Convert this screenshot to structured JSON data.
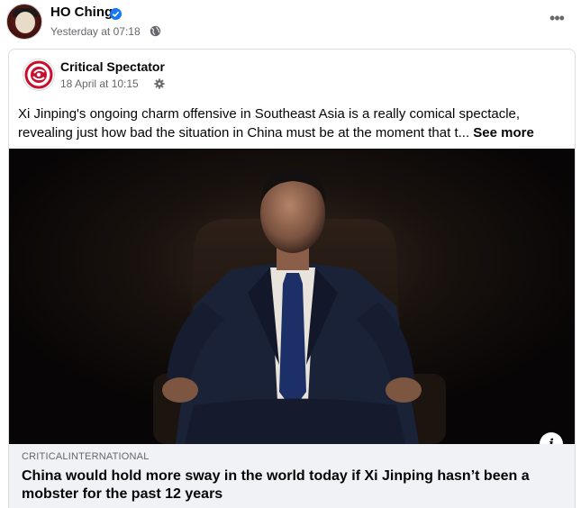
{
  "post": {
    "author_name": "HO Ching",
    "timestamp": "Yesterday at 07:18",
    "verified": true,
    "audience_icon": "globe-icon",
    "more_icon": "more-options-icon"
  },
  "shared_post": {
    "page_name": "Critical Spectator",
    "date": "18 April at 10:15",
    "settings_icon": "gear-icon",
    "text": "Xi Jinping's ongoing charm offensive in Southeast Asia is a really comical spectacle, revealing just how bad the situation in China must be at the moment that t...",
    "see_more": "See more",
    "brand_color": "#c8102e"
  },
  "link_preview": {
    "domain": "CRITICALINTERNATIONAL",
    "title": "China would hold more sway in the world today if Xi Jinping hasn’t been a mobster for the past 12 years",
    "info_label": "i"
  },
  "colors": {
    "verified_blue": "#1877f2",
    "secondary_text": "#65676b",
    "footer_bg": "#f0f2f5"
  }
}
